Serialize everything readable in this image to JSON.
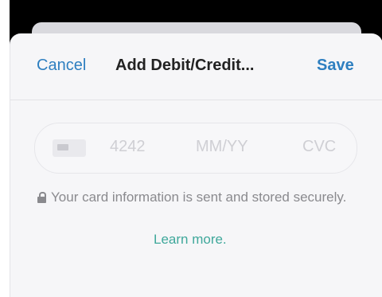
{
  "nav": {
    "cancel_label": "Cancel",
    "title": "Add Debit/Credit...",
    "save_label": "Save"
  },
  "card_field": {
    "number_placeholder": "4242",
    "expiry_placeholder": "MM/YY",
    "cvc_placeholder": "CVC",
    "icon": "credit-card-icon"
  },
  "security": {
    "icon": "lock-icon",
    "message": "Your card information is sent and stored securely.",
    "learn_more_label": "Learn more."
  },
  "colors": {
    "accent_blue": "#2e7fc0",
    "link_teal": "#3fa89b",
    "placeholder_gray": "#cfcfd4",
    "secondary_text": "#8a8a8e"
  }
}
